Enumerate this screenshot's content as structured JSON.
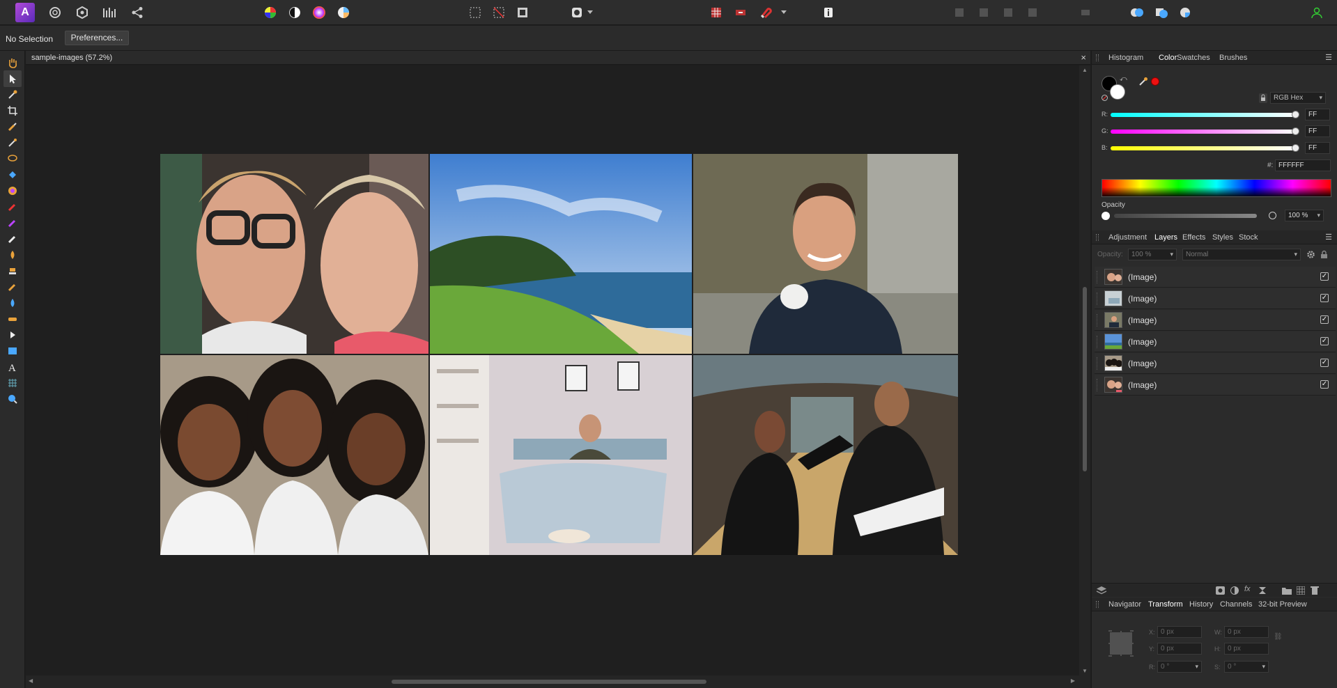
{
  "context": {
    "selection": "No Selection",
    "preferences_label": "Preferences..."
  },
  "document": {
    "title": "sample-images (57.2%)",
    "close_glyph": "×"
  },
  "color_panel": {
    "tabs": [
      "Histogram",
      "Color",
      "Swatches",
      "Brushes"
    ],
    "active_tab": "Color",
    "mode": "RGB Hex",
    "channels": [
      {
        "label": "R:",
        "value": "FF",
        "color": "#00ffff"
      },
      {
        "label": "G:",
        "value": "FF",
        "color": "#ff00ff"
      },
      {
        "label": "B:",
        "value": "FF",
        "color": "#ffff00"
      }
    ],
    "hex_label": "#:",
    "hex_value": "FFFFFF",
    "opacity_label": "Opacity",
    "opacity_value": "100 %"
  },
  "layers_panel": {
    "tabs": [
      "Adjustment",
      "Layers",
      "Effects",
      "Styles",
      "Stock"
    ],
    "active_tab": "Layers",
    "opacity_label": "Opacity:",
    "opacity_value": "100 %",
    "blend_mode": "Normal",
    "layers": [
      {
        "name": "(Image)",
        "visible": true
      },
      {
        "name": "(Image)",
        "visible": true
      },
      {
        "name": "(Image)",
        "visible": true
      },
      {
        "name": "(Image)",
        "visible": true
      },
      {
        "name": "(Image)",
        "visible": true
      },
      {
        "name": "(Image)",
        "visible": true
      }
    ]
  },
  "transform_panel": {
    "tabs": [
      "Navigator",
      "Transform",
      "History",
      "Channels",
      "32-bit Preview"
    ],
    "active_tab": "Transform",
    "x_label": "X:",
    "x": "0 px",
    "y_label": "Y:",
    "y": "0 px",
    "w_label": "W:",
    "w": "0 px",
    "h_label": "H:",
    "h": "0 px",
    "r_label": "R:",
    "r": "0 °",
    "s_label": "S:",
    "s": "0 °"
  },
  "menu_glyph": "☰"
}
